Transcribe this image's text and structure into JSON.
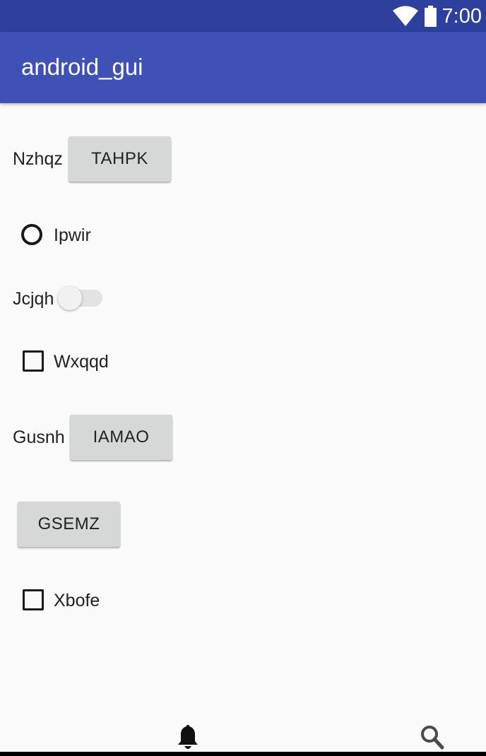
{
  "status_bar": {
    "time": "7:00",
    "icons": [
      "wifi-icon",
      "battery-icon"
    ],
    "color": "#2f3f9e"
  },
  "app_bar": {
    "title": "android_gui",
    "color": "#3f51b5"
  },
  "rows": {
    "nzhqz_label": "Nzhqz",
    "tahpk_button": "TAHPK",
    "ipwir_radio_label": "Ipwir",
    "ipwir_checked": false,
    "jcjqh_label": "Jcjqh",
    "jcjqh_on": false,
    "wxqqd_checkbox_label": "Wxqqd",
    "wxqqd_checked": false,
    "gusnh_label": "Gusnh",
    "iamao_button": "IAMAO",
    "gsemz_button": "GSEMZ",
    "xbofe_checkbox_label": "Xbofe",
    "xbofe_checked": false
  },
  "bottom_nav": {
    "icons": [
      "bell-icon",
      "search-icon"
    ]
  }
}
